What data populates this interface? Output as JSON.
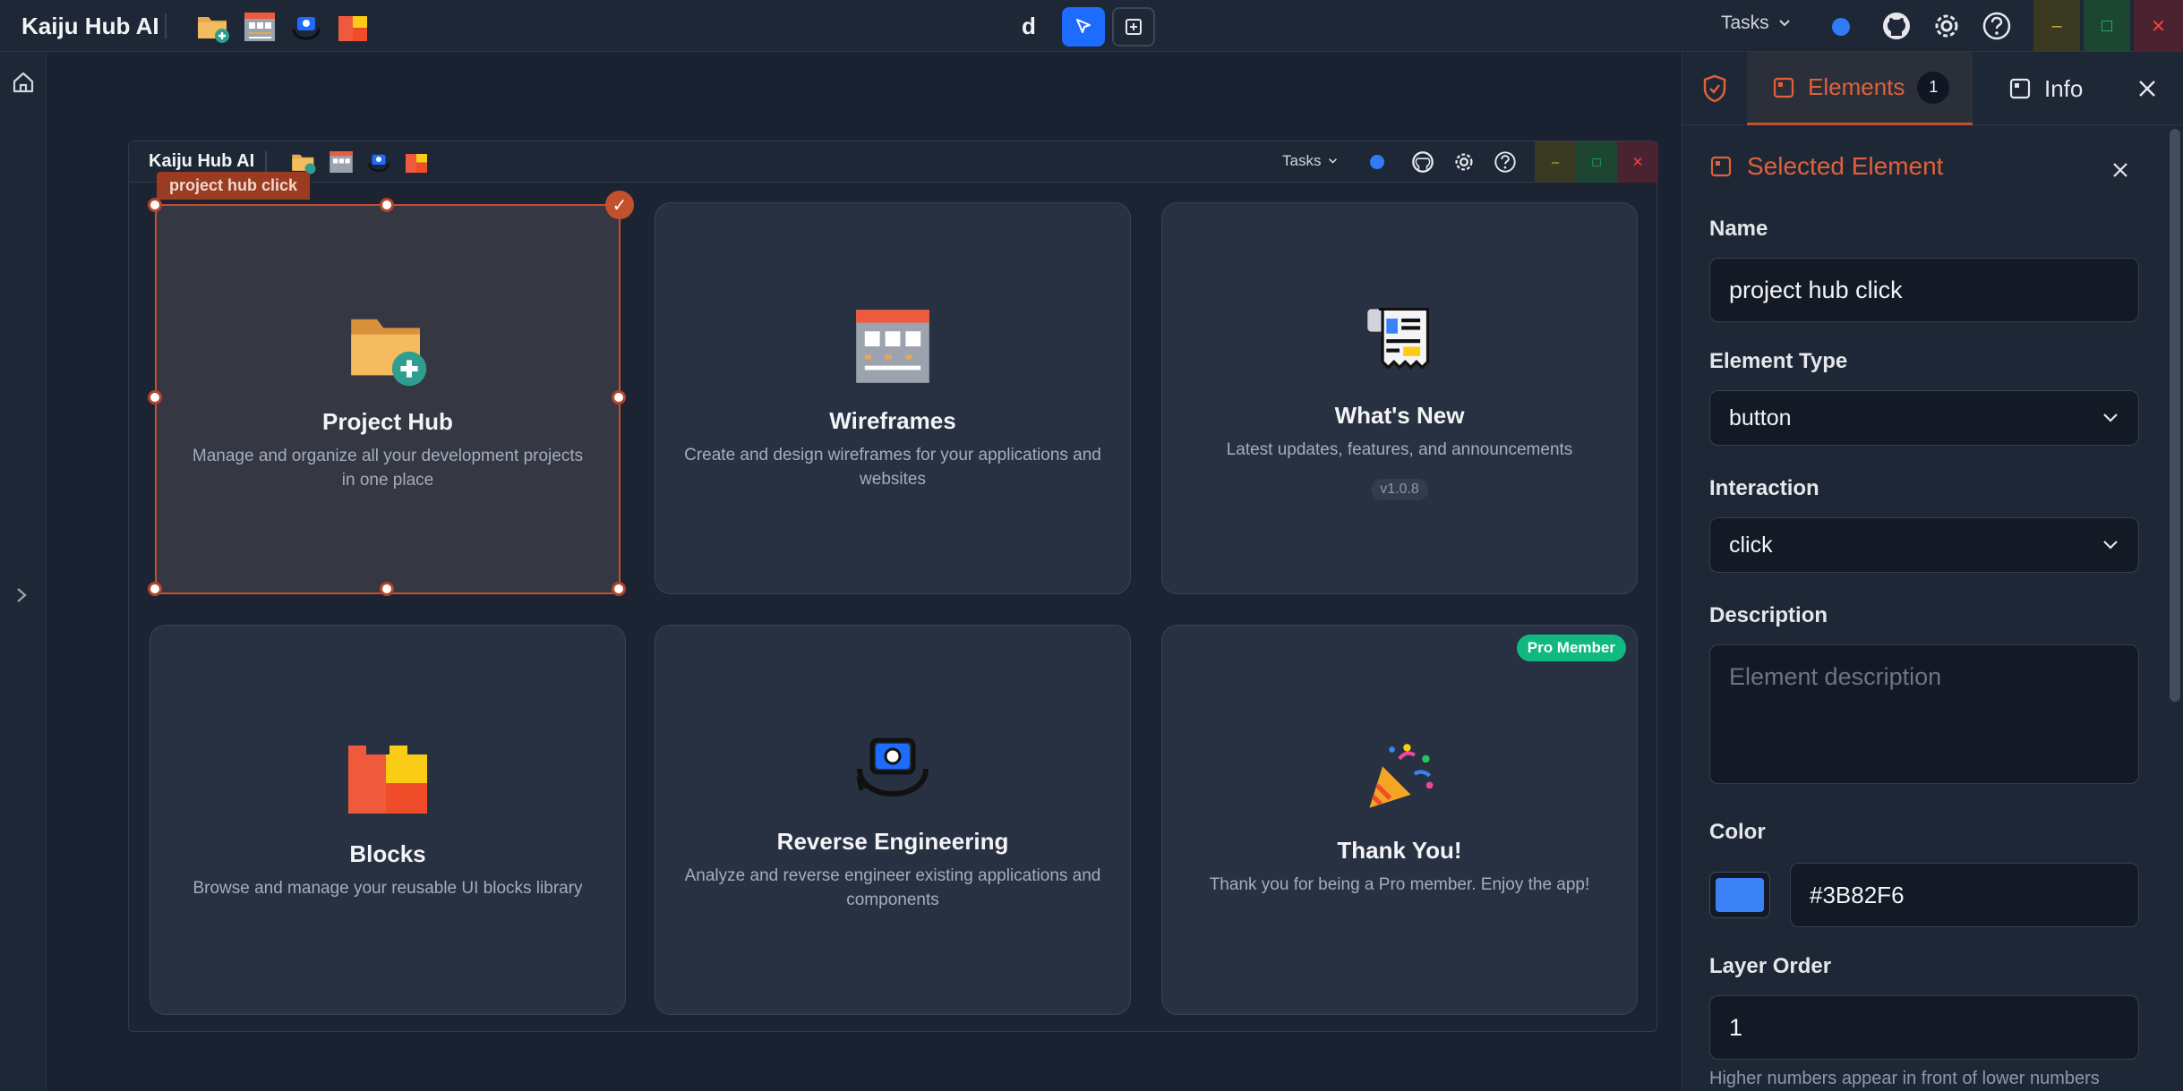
{
  "app": {
    "title": "Kaiju Hub AI",
    "mode_letter": "d",
    "tasks_label": "Tasks",
    "accent_color": "#c2512e",
    "status_dot_color": "#2f7cf6"
  },
  "preview": {
    "title": "Kaiju Hub AI",
    "tasks_label": "Tasks",
    "selection_label": "project hub click",
    "cards": [
      {
        "title": "Project Hub",
        "description": "Manage and organize all your development projects in one place",
        "icon": "folder-add-icon"
      },
      {
        "title": "Wireframes",
        "description": "Create and design wireframes for your applications and websites",
        "icon": "wireframe-grid-icon"
      },
      {
        "title": "What's New",
        "description": "Latest updates, features, and announcements",
        "badge": "v1.0.8",
        "icon": "newspaper-icon"
      },
      {
        "title": "Blocks",
        "description": "Browse and manage your reusable UI blocks library",
        "icon": "blocks-icon"
      },
      {
        "title": "Reverse Engineering",
        "description": "Analyze and reverse engineer existing applications and components",
        "icon": "camera-rotate-icon"
      },
      {
        "title": "Thank You!",
        "description": "Thank you for being a Pro member. Enjoy the app!",
        "pro_badge": "Pro Member",
        "icon": "party-popper-icon"
      }
    ]
  },
  "panel": {
    "tabs": [
      {
        "label": "Elements",
        "count": "1"
      },
      {
        "label": "Info"
      }
    ],
    "selected_heading": "Selected Element",
    "name_label": "Name",
    "name_value": "project hub click",
    "type_label": "Element Type",
    "type_value": "button",
    "interaction_label": "Interaction",
    "interaction_value": "click",
    "description_label": "Description",
    "description_placeholder": "Element description",
    "color_label": "Color",
    "color_value": "#3B82F6",
    "layer_label": "Layer Order",
    "layer_value": "1",
    "layer_hint": "Higher numbers appear in front of lower numbers"
  }
}
